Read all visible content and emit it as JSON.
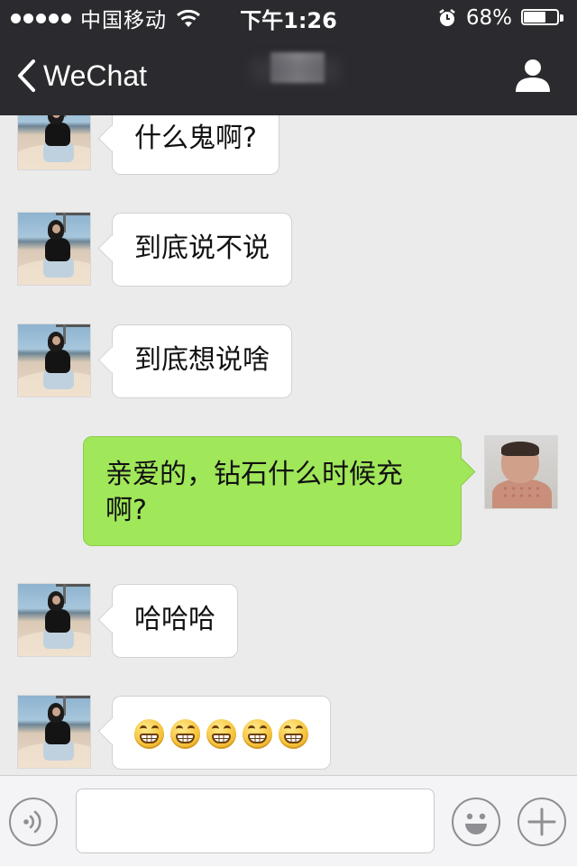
{
  "status_bar": {
    "carrier": "中国移动",
    "time": "下午1:26",
    "battery": "68%",
    "battery_level": 0.68,
    "signal_bars": 5,
    "icons": [
      "signal-dots-icon",
      "wifi-icon",
      "alarm-icon",
      "battery-icon"
    ]
  },
  "nav": {
    "back_label": "WeChat",
    "title_obscured": true,
    "icons": [
      "back-chevron-icon",
      "profile-icon"
    ]
  },
  "messages": [
    {
      "sender": "contact",
      "text": "什么鬼啊?"
    },
    {
      "sender": "contact",
      "text": "到底说不说"
    },
    {
      "sender": "contact",
      "text": "到底想说啥"
    },
    {
      "sender": "me",
      "lines": [
        "亲爱的，钻石什么时候充",
        "啊?"
      ]
    },
    {
      "sender": "contact",
      "text": "哈哈哈"
    },
    {
      "sender": "contact",
      "emoji_count": 5,
      "emoji_icon": "grin-emoji-icon"
    }
  ],
  "input_bar": {
    "value": "",
    "icons": [
      "voice-icon",
      "emoji-icon",
      "plus-icon"
    ]
  },
  "colors": {
    "bar_bg": "#2b2b2f",
    "chat_bg": "#ebebeb",
    "outgoing_bubble": "#a0e75a",
    "incoming_bubble": "#ffffff"
  }
}
